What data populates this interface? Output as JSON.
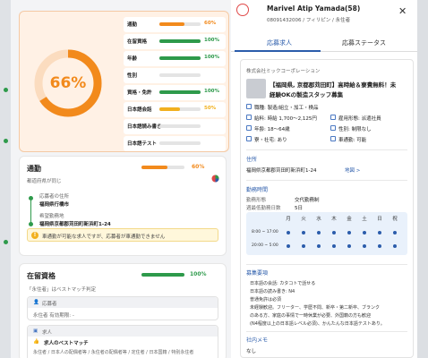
{
  "match": {
    "percent": "66%",
    "gauge_fraction": 0.66,
    "criteria": [
      {
        "label": "通勤",
        "pct": "60%",
        "fill": 0.6,
        "color": "#f28a1c"
      },
      {
        "label": "在留資格",
        "pct": "100%",
        "fill": 1.0,
        "color": "#2e9a4b"
      },
      {
        "label": "年齢",
        "pct": "100%",
        "fill": 1.0,
        "color": "#2e9a4b"
      },
      {
        "label": "性別",
        "pct": "",
        "fill": 0,
        "color": "#2e9a4b"
      },
      {
        "label": "資格・免許",
        "pct": "100%",
        "fill": 1.0,
        "color": "#2e9a4b"
      },
      {
        "label": "日本語会話",
        "pct": "50%",
        "fill": 0.5,
        "color": "#f2b01e"
      },
      {
        "label": "日本語読み書き",
        "pct": "",
        "fill": 0,
        "color": "#2e9a4b"
      },
      {
        "label": "日本語テスト",
        "pct": "",
        "fill": 0,
        "color": "#2e9a4b"
      }
    ]
  },
  "commute": {
    "title": "通勤",
    "pct": "60%",
    "fill": 0.6,
    "note": "都道府県が同じ",
    "applicant_addr_label": "応募者の住所",
    "applicant_addr": "福岡県行橋市",
    "work_label": "希望勤務地",
    "work_addr": "福岡県京都郡苅田町新浜町1-24",
    "warning": "車通勤が可能な求人ですが、応募者が車通勤できません"
  },
  "status": {
    "title": "在留資格",
    "pct": "100%",
    "fill": 1.0,
    "note": "「永住者」はベストマッチ判定",
    "applicant_label": "応募者",
    "applicant_value": "永住者 有効期限: -",
    "job_label": "求人",
    "job_match": "求人のベストマッチ",
    "job_value": "永住者 / 日本人の配偶者等 / 永住者の配偶者等 / 定住者 / 日本国籍 / 特別永住者"
  },
  "profile": {
    "name": "Marivel Atip Yamada(58)",
    "sub": "08091432006 / フィリピン / 永住者"
  },
  "tabs": {
    "jobs": "応募求人",
    "status": "応募ステータス"
  },
  "job": {
    "company": "株式会社ミックコーポレーション",
    "title_line1": "【福岡県, 京都郡苅田町】高時給＆寮費無料！未",
    "title_line2": "経験OKの製造スタッフ募集",
    "occupation": "職種: 製造/組立・加工・検品",
    "wage": "給料: 時給 1,700～2,125円",
    "employment": "雇用形態: 派遣社員",
    "age": "年齢: 18～64歳",
    "gender": "性別: 制限なし",
    "dorm": "寮・社宅: あり",
    "car": "車通勤: 可能",
    "address_section": "住所",
    "address": "福岡県京都郡苅田町新浜町1-24",
    "map_link": "地図 >",
    "hours_section": "勤務時間",
    "shift_label": "勤務形態",
    "shift_value": "交代勤務制",
    "days_label": "週最低勤務日数",
    "days_value": "5日",
    "weekdays": [
      "月",
      "火",
      "水",
      "木",
      "金",
      "土",
      "日",
      "祝"
    ],
    "slots": [
      {
        "time": "8:00 ~ 17:00",
        "days": [
          1,
          1,
          1,
          1,
          1,
          1,
          1,
          1
        ]
      },
      {
        "time": "20:00 ~ 5:00",
        "days": [
          1,
          1,
          1,
          1,
          1,
          1,
          1,
          1
        ]
      }
    ],
    "req_section": "募集要項",
    "requirements": [
      "日本語の会話: カタコトで話せる",
      "日本語の読み書き: N4",
      "普通免許は必須",
      "未経験歓迎。フリーター、学歴不問、新卒・第二新卒、ブランク",
      "のある方、家庭の事情で一時休業が必要、外国籍の方も歓迎",
      "(N4程度以上の日本語レベル必須)、かんたんな日本語テストあり。"
    ],
    "memo_section": "社内メモ",
    "memo": "なし"
  }
}
